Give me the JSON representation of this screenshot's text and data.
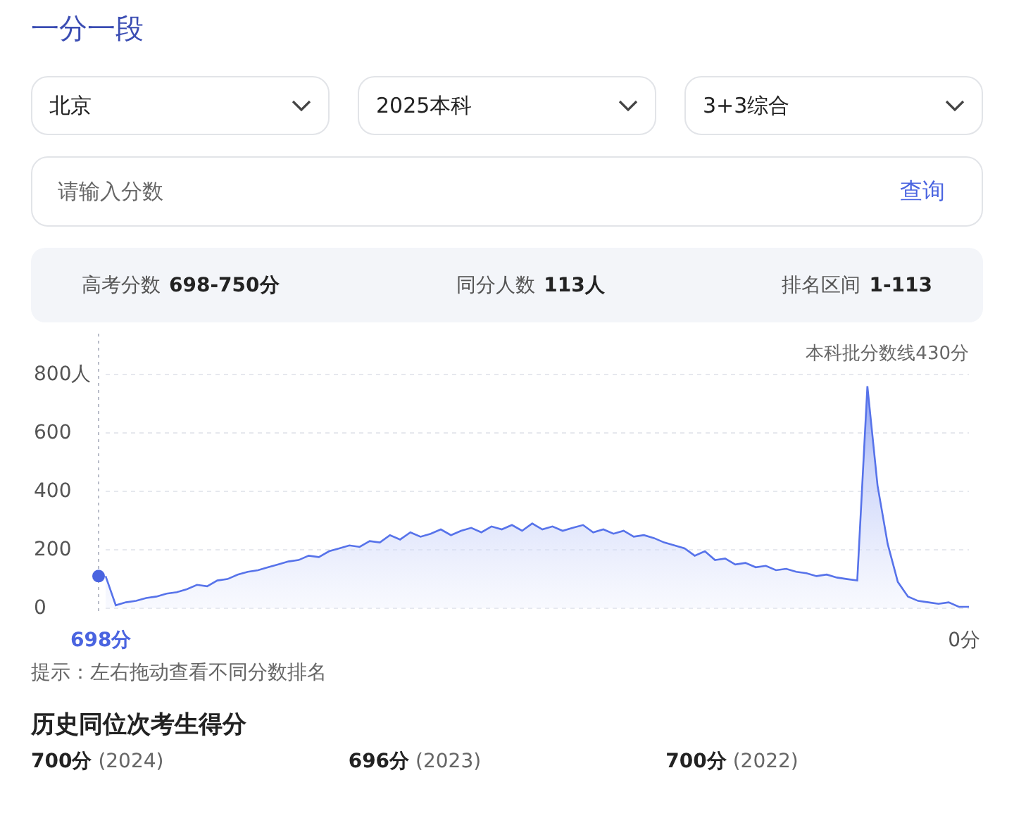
{
  "title": "一分一段",
  "selects": [
    {
      "value": "北京"
    },
    {
      "value": "2025本科"
    },
    {
      "value": "3+3综合"
    }
  ],
  "search": {
    "placeholder": "请输入分数",
    "button": "查询"
  },
  "stats": [
    {
      "label": "高考分数",
      "value": "698-750分"
    },
    {
      "label": "同分人数",
      "value": "113人"
    },
    {
      "label": "排名区间",
      "value": "1-113"
    }
  ],
  "chart": {
    "start_label": "698分",
    "end_label": "0分",
    "chart_data": {
      "type": "area",
      "grid": true,
      "ylim": [
        0,
        800
      ],
      "yticks": [
        0,
        200,
        400,
        600,
        {
          "value": 800,
          "label": "800人"
        }
      ],
      "values": [
        110,
        10,
        20,
        25,
        35,
        40,
        50,
        55,
        65,
        80,
        75,
        95,
        100,
        115,
        125,
        130,
        140,
        150,
        160,
        165,
        180,
        175,
        195,
        205,
        215,
        210,
        230,
        225,
        250,
        235,
        260,
        245,
        255,
        270,
        250,
        265,
        275,
        260,
        280,
        270,
        285,
        265,
        290,
        270,
        280,
        265,
        275,
        285,
        260,
        270,
        255,
        265,
        245,
        250,
        240,
        225,
        215,
        205,
        180,
        195,
        165,
        170,
        150,
        155,
        140,
        145,
        130,
        135,
        125,
        120,
        110,
        115,
        105,
        100,
        95,
        760,
        420,
        220,
        90,
        40,
        25,
        20,
        15,
        20,
        5,
        5
      ],
      "annotations": [
        "本科批分数线430分"
      ]
    }
  },
  "hint": "提示：左右拖动查看不同分数排名",
  "history": {
    "title": "历史同位次考生得分",
    "items": [
      {
        "score": "700分",
        "year": "(2024)"
      },
      {
        "score": "696分",
        "year": "(2023)"
      },
      {
        "score": "700分",
        "year": "(2022)"
      }
    ]
  }
}
